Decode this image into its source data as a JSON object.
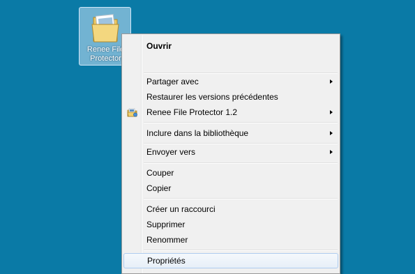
{
  "desktop": {
    "icon_label": "Renee File\nProtector"
  },
  "menu": {
    "items": [
      {
        "label": "Ouvrir"
      },
      {
        "label": "Partager avec"
      },
      {
        "label": "Restaurer les versions précédentes"
      },
      {
        "label": "Renee File Protector 1.2"
      },
      {
        "label": "Inclure dans la bibliothèque"
      },
      {
        "label": "Envoyer vers"
      },
      {
        "label": "Couper"
      },
      {
        "label": "Copier"
      },
      {
        "label": "Créer un raccourci"
      },
      {
        "label": "Supprimer"
      },
      {
        "label": "Renommer"
      },
      {
        "label": "Propriétés"
      }
    ]
  },
  "colors": {
    "desktop_background": "#0a7aa6",
    "menu_background": "#f0f0f0",
    "hover_border": "#aeccef"
  }
}
